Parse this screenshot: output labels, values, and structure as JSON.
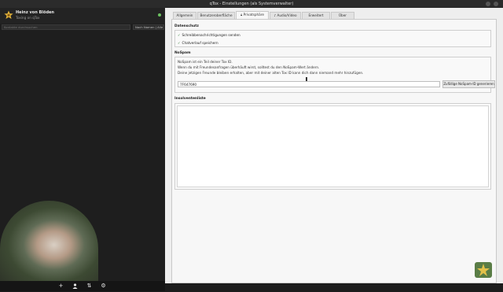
{
  "window": {
    "title": "qTox - Einstellungen (als Systemverwalter)"
  },
  "profile": {
    "name": "Heinz von Blöden",
    "status": "Toxing on qTox"
  },
  "search": {
    "placeholder": "Kontakte durchsuchen",
    "sort": "Nach Namen | Alle"
  },
  "tabs": [
    {
      "label": "Allgemein"
    },
    {
      "label": "Benutzeroberfläche"
    },
    {
      "label": "Privatsphäre"
    },
    {
      "label": "Audio/Video"
    },
    {
      "label": "Erweitert"
    },
    {
      "label": "Über"
    }
  ],
  "privacy": {
    "title": "Datenschutz",
    "typing": "Schreibbenachrichtigungen senden",
    "history": "Chatverlauf speichern"
  },
  "nospam": {
    "title": "NoSpam",
    "line1": "NoSpam ist ein Teil deiner Tox ID.",
    "line2": "Wenn du mit Freundesanfragen überhäuft wirst, solltest du den NoSpam-Wert ändern.",
    "line3": "Deine jetzigen Freunde bleiben erhalten, aber mit deiner alten Tox ID kann dich dann niemand mehr hinzufügen.",
    "value": "7F647690",
    "generate": "Zufällige NoSpam-ID generieren"
  },
  "blacklist": {
    "title": "Insolventenliste"
  },
  "bottombar": {
    "add": "+",
    "transfers": "⇅",
    "settings": "⚙"
  },
  "icons": {
    "avatar": "star-icon",
    "status": "status-online-icon",
    "add": "plus-icon",
    "groups": "group-icon",
    "transfers": "transfer-icon",
    "settings": "gear-icon",
    "tray": "qtox-tray-icon",
    "privacy-tab": "lock-icon",
    "audio-tab": "speaker-icon"
  },
  "colors": {
    "online": "#6bc260",
    "accent": "#2e7d32",
    "sidebar": "#1e1e1e"
  }
}
